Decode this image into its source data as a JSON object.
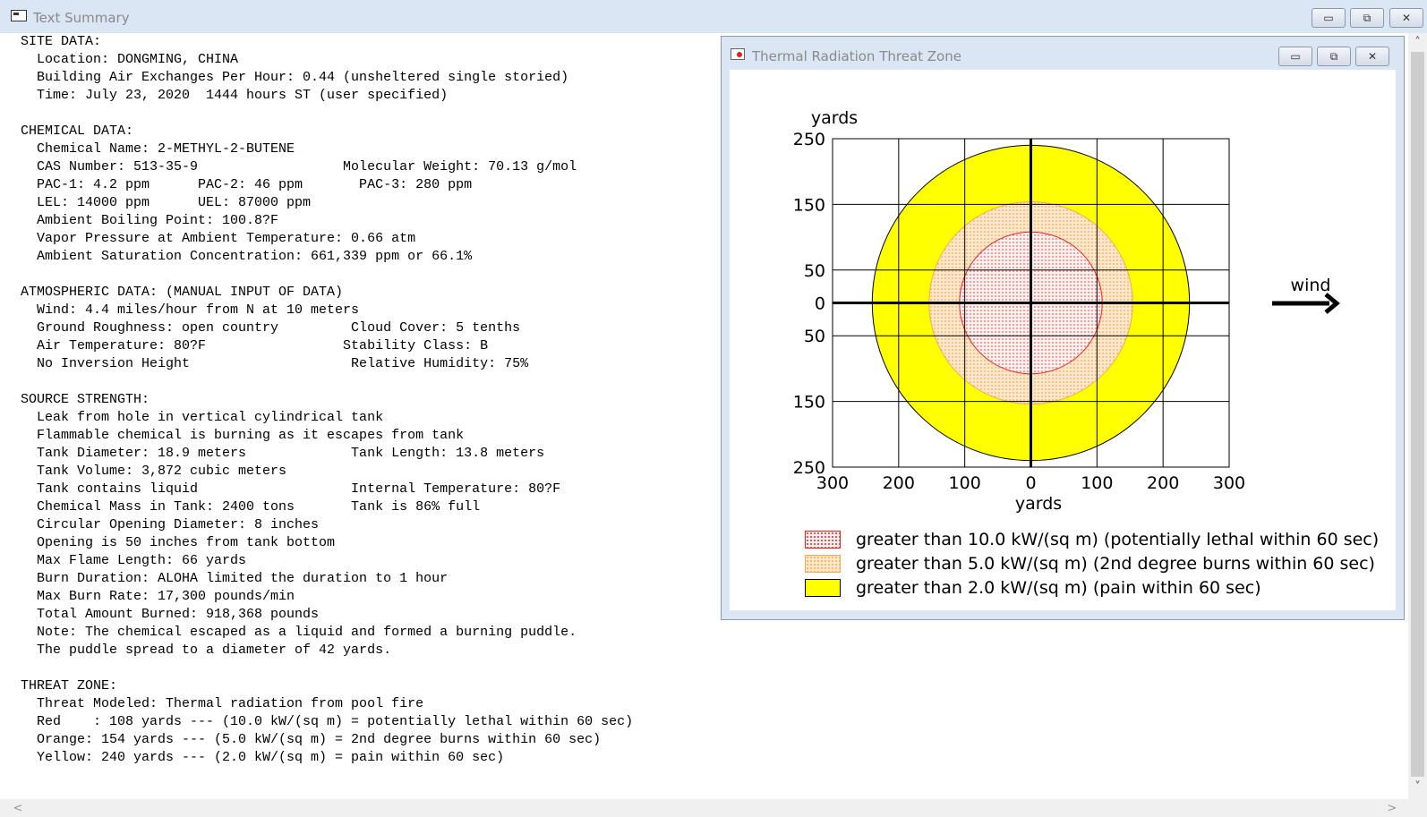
{
  "main_window": {
    "title": "Text Summary",
    "buttons": {
      "minimize": "▭",
      "maximize": "⧉",
      "close": "✕"
    }
  },
  "summary_lines": [
    "SITE DATA:",
    "  Location: DONGMING, CHINA",
    "  Building Air Exchanges Per Hour: 0.44 (unsheltered single storied)",
    "  Time: July 23, 2020  1444 hours ST (user specified)",
    "",
    "CHEMICAL DATA:",
    "  Chemical Name: 2-METHYL-2-BUTENE",
    "  CAS Number: 513-35-9                  Molecular Weight: 70.13 g/mol",
    "  PAC-1: 4.2 ppm      PAC-2: 46 ppm       PAC-3: 280 ppm",
    "  LEL: 14000 ppm      UEL: 87000 ppm",
    "  Ambient Boiling Point: 100.8?F",
    "  Vapor Pressure at Ambient Temperature: 0.66 atm",
    "  Ambient Saturation Concentration: 661,339 ppm or 66.1%",
    "",
    "ATMOSPHERIC DATA: (MANUAL INPUT OF DATA)",
    "  Wind: 4.4 miles/hour from N at 10 meters",
    "  Ground Roughness: open country         Cloud Cover: 5 tenths",
    "  Air Temperature: 80?F                 Stability Class: B",
    "  No Inversion Height                    Relative Humidity: 75%",
    "",
    "SOURCE STRENGTH:",
    "  Leak from hole in vertical cylindrical tank",
    "  Flammable chemical is burning as it escapes from tank",
    "  Tank Diameter: 18.9 meters             Tank Length: 13.8 meters",
    "  Tank Volume: 3,872 cubic meters",
    "  Tank contains liquid                   Internal Temperature: 80?F",
    "  Chemical Mass in Tank: 2400 tons       Tank is 86% full",
    "  Circular Opening Diameter: 8 inches",
    "  Opening is 50 inches from tank bottom",
    "  Max Flame Length: 66 yards",
    "  Burn Duration: ALOHA limited the duration to 1 hour",
    "  Max Burn Rate: 17,300 pounds/min",
    "  Total Amount Burned: 918,368 pounds",
    "  Note: The chemical escaped as a liquid and formed a burning puddle.",
    "  The puddle spread to a diameter of 42 yards.",
    "",
    "THREAT ZONE:",
    "  Threat Modeled: Thermal radiation from pool fire",
    "  Red    : 108 yards --- (10.0 kW/(sq m) = potentially lethal within 60 sec)",
    "  Orange: 154 yards --- (5.0 kW/(sq m) = 2nd degree burns within 60 sec)",
    "  Yellow: 240 yards --- (2.0 kW/(sq m) = pain within 60 sec)"
  ],
  "threat_window": {
    "title": "Thermal Radiation Threat Zone",
    "buttons": {
      "minimize": "▭",
      "maximize": "⧉",
      "close": "✕"
    }
  },
  "chart_data": {
    "type": "area",
    "ylabel": "yards",
    "xlabel": "yards",
    "xlim": [
      -300,
      300
    ],
    "ylim": [
      -250,
      250
    ],
    "x_gridlines": [
      -300,
      -200,
      -100,
      0,
      100,
      200,
      300
    ],
    "y_gridlines": [
      -250,
      -150,
      -50,
      50,
      150,
      250
    ],
    "x_ticks": [
      {
        "value": -300,
        "label": "300"
      },
      {
        "value": -200,
        "label": "200"
      },
      {
        "value": -100,
        "label": "100"
      },
      {
        "value": 0,
        "label": "0"
      },
      {
        "value": 100,
        "label": "100"
      },
      {
        "value": 200,
        "label": "200"
      },
      {
        "value": 300,
        "label": "300"
      }
    ],
    "y_ticks": [
      {
        "value": 250,
        "label": "250"
      },
      {
        "value": 150,
        "label": "150"
      },
      {
        "value": 50,
        "label": "50"
      },
      {
        "value": 0,
        "label": "0"
      },
      {
        "value": -50,
        "label": "50"
      },
      {
        "value": -150,
        "label": "150"
      },
      {
        "value": -250,
        "label": "250"
      }
    ],
    "grid": true,
    "wind_label": "wind",
    "wind_direction": "east",
    "zones": [
      {
        "color": "#ffff00",
        "radius_yards": 240,
        "pattern": "solid",
        "label": "greater than 2.0 kW/(sq m) (pain within 60 sec)"
      },
      {
        "color": "#f7a94f",
        "radius_yards": 154,
        "pattern": "dotted",
        "label": "greater than 5.0 kW/(sq m) (2nd degree burns within 60 sec)"
      },
      {
        "color": "#e8231b",
        "radius_yards": 108,
        "pattern": "dotted",
        "label": "greater than 10.0 kW/(sq m) (potentially lethal within 60 sec)"
      }
    ],
    "legend": [
      {
        "color": "#e8231b",
        "pattern": "dotted",
        "label": "greater than 10.0 kW/(sq m) (potentially lethal within 60 sec)"
      },
      {
        "color": "#f7a94f",
        "pattern": "dotted",
        "label": "greater than 5.0 kW/(sq m) (2nd degree burns within 60 sec)"
      },
      {
        "color": "#ffff00",
        "pattern": "solid",
        "label": "greater than 2.0 kW/(sq m) (pain within 60 sec)"
      }
    ]
  },
  "scrollbars": {
    "up": "˄",
    "down": "˅",
    "left": "<",
    "right": ">"
  }
}
